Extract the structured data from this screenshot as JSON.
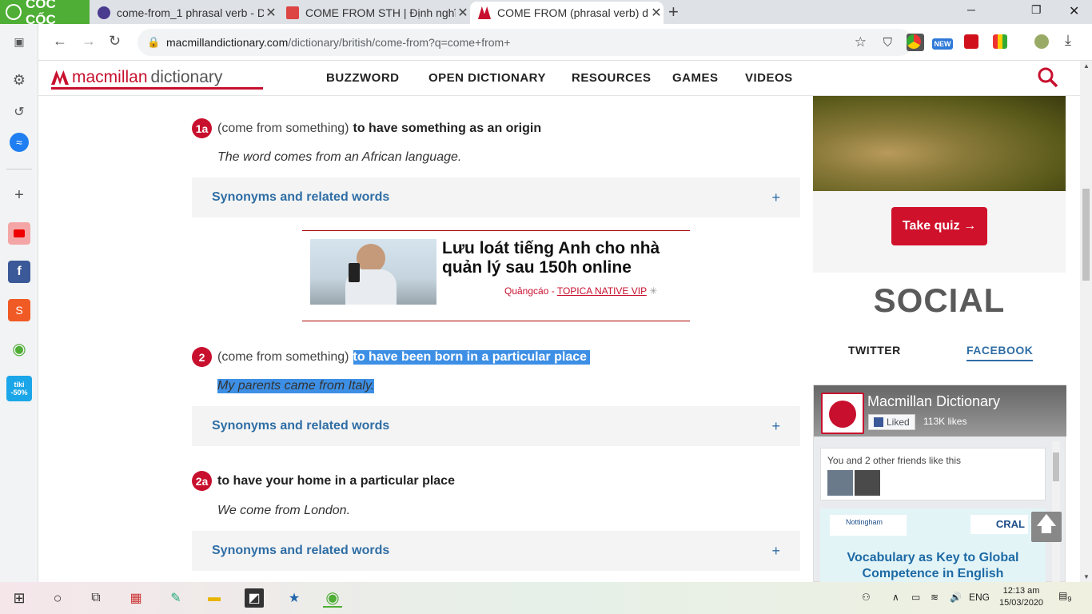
{
  "browser": {
    "brand": "CỐC CỐC",
    "tabs": [
      {
        "title": "come-from_1 phrasal verb - D",
        "active": false
      },
      {
        "title": "COME FROM STH | Định nghĩ",
        "active": false
      },
      {
        "title": "COME FROM (phrasal verb) d",
        "active": true
      }
    ],
    "url_domain": "macmillandictionary.com",
    "url_path": "/dictionary/british/come-from?q=come+from+",
    "new_badge": "NEW"
  },
  "sidebar_icons": [
    "window-icon",
    "gear-icon",
    "history-icon",
    "messenger-icon",
    "add-icon",
    "youtube-icon",
    "facebook-icon",
    "shopee-icon",
    "coccoc-icon",
    "tiki-icon"
  ],
  "tiki_label": "tiki -50%",
  "site": {
    "logo_macmillan": "macmillan",
    "logo_dictionary": "dictionary",
    "nav": [
      "BUZZWORD",
      "OPEN DICTIONARY",
      "RESOURCES",
      "GAMES",
      "VIDEOS"
    ]
  },
  "senses": [
    {
      "num": "1a",
      "gram": "(come from something)",
      "def": "to have something as an origin",
      "example": "The word comes from an African language.",
      "highlight": false
    },
    {
      "num": "2",
      "gram": "(come from something)",
      "def": "to have been born in a particular place",
      "example": "My parents came from Italy.",
      "highlight": true
    },
    {
      "num": "2a",
      "gram": "",
      "def": "to have your home in a particular place",
      "example": "We come from London.",
      "highlight": false
    }
  ],
  "synonyms_label": "Synonyms and related words",
  "plus": "+",
  "ad": {
    "title": "Lưu loát tiếng Anh cho nhà quản lý sau 150h online",
    "label": "Quảngcáo - ",
    "source": "TOPICA NATIVE VIP"
  },
  "right": {
    "quiz_button": "Take quiz →",
    "social_heading": "SOCIAL",
    "tabs": [
      "TWITTER",
      "FACEBOOK"
    ],
    "fb_name": "Macmillan Dictionary",
    "fb_liked": "Liked",
    "fb_likes": "113K likes",
    "fb_friends": "You and 2 other friends like this",
    "fb_ad": "Vocabulary as Key to Global Competence in English",
    "fb_ad_org1": "Nottingham",
    "fb_ad_org2": "CRAL"
  },
  "taskbar": {
    "lang": "ENG",
    "time": "12:13 am",
    "date": "15/03/2020",
    "notif": "9"
  }
}
